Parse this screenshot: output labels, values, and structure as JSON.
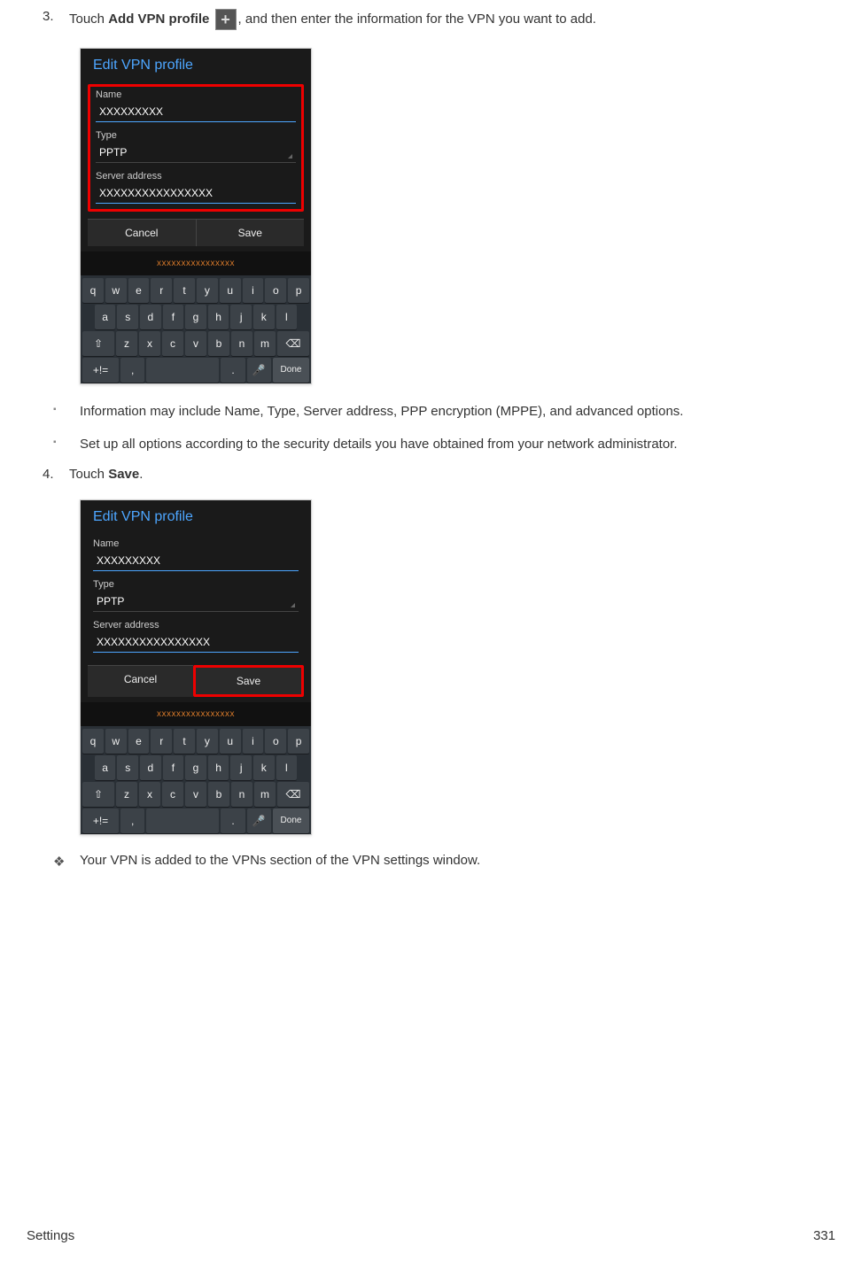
{
  "step3": {
    "number": "3.",
    "text_before": "Touch ",
    "bold_text": "Add VPN profile",
    "text_after": ", and then enter the information for the VPN you want to add."
  },
  "screenshot1": {
    "title": "Edit VPN profile",
    "name_label": "Name",
    "name_value": "XXXXXXXXX",
    "type_label": "Type",
    "type_value": "PPTP",
    "server_label": "Server address",
    "server_value": "XXXXXXXXXXXXXXXX",
    "cancel": "Cancel",
    "save": "Save",
    "suggestion": "xxxxxxxxxxxxxxxx",
    "done": "Done"
  },
  "sub1": "Information may include Name, Type, Server address, PPP encryption (MPPE), and advanced options.",
  "sub2": "Set up all options according to the security details you have obtained from your network administrator.",
  "step4": {
    "number": "4.",
    "text": "Touch ",
    "bold": "Save",
    "suffix": "."
  },
  "screenshot2": {
    "title": "Edit VPN profile",
    "name_label": "Name",
    "name_value": "XXXXXXXXX",
    "type_label": "Type",
    "type_value": "PPTP",
    "server_label": "Server address",
    "server_value": "XXXXXXXXXXXXXXXX",
    "cancel": "Cancel",
    "save": "Save",
    "suggestion": "xxxxxxxxxxxxxxxx",
    "done": "Done"
  },
  "result": "Your VPN is added to the VPNs section of the VPN settings window.",
  "footer": {
    "left": "Settings",
    "right": "331"
  },
  "kb": {
    "r1": [
      "q",
      "w",
      "e",
      "r",
      "t",
      "y",
      "u",
      "i",
      "o",
      "p"
    ],
    "r2": [
      "a",
      "s",
      "d",
      "f",
      "g",
      "h",
      "j",
      "k",
      "l"
    ],
    "r3": [
      "⇧",
      "z",
      "x",
      "c",
      "v",
      "b",
      "n",
      "m",
      "⌫"
    ],
    "sym": "+!="
  }
}
